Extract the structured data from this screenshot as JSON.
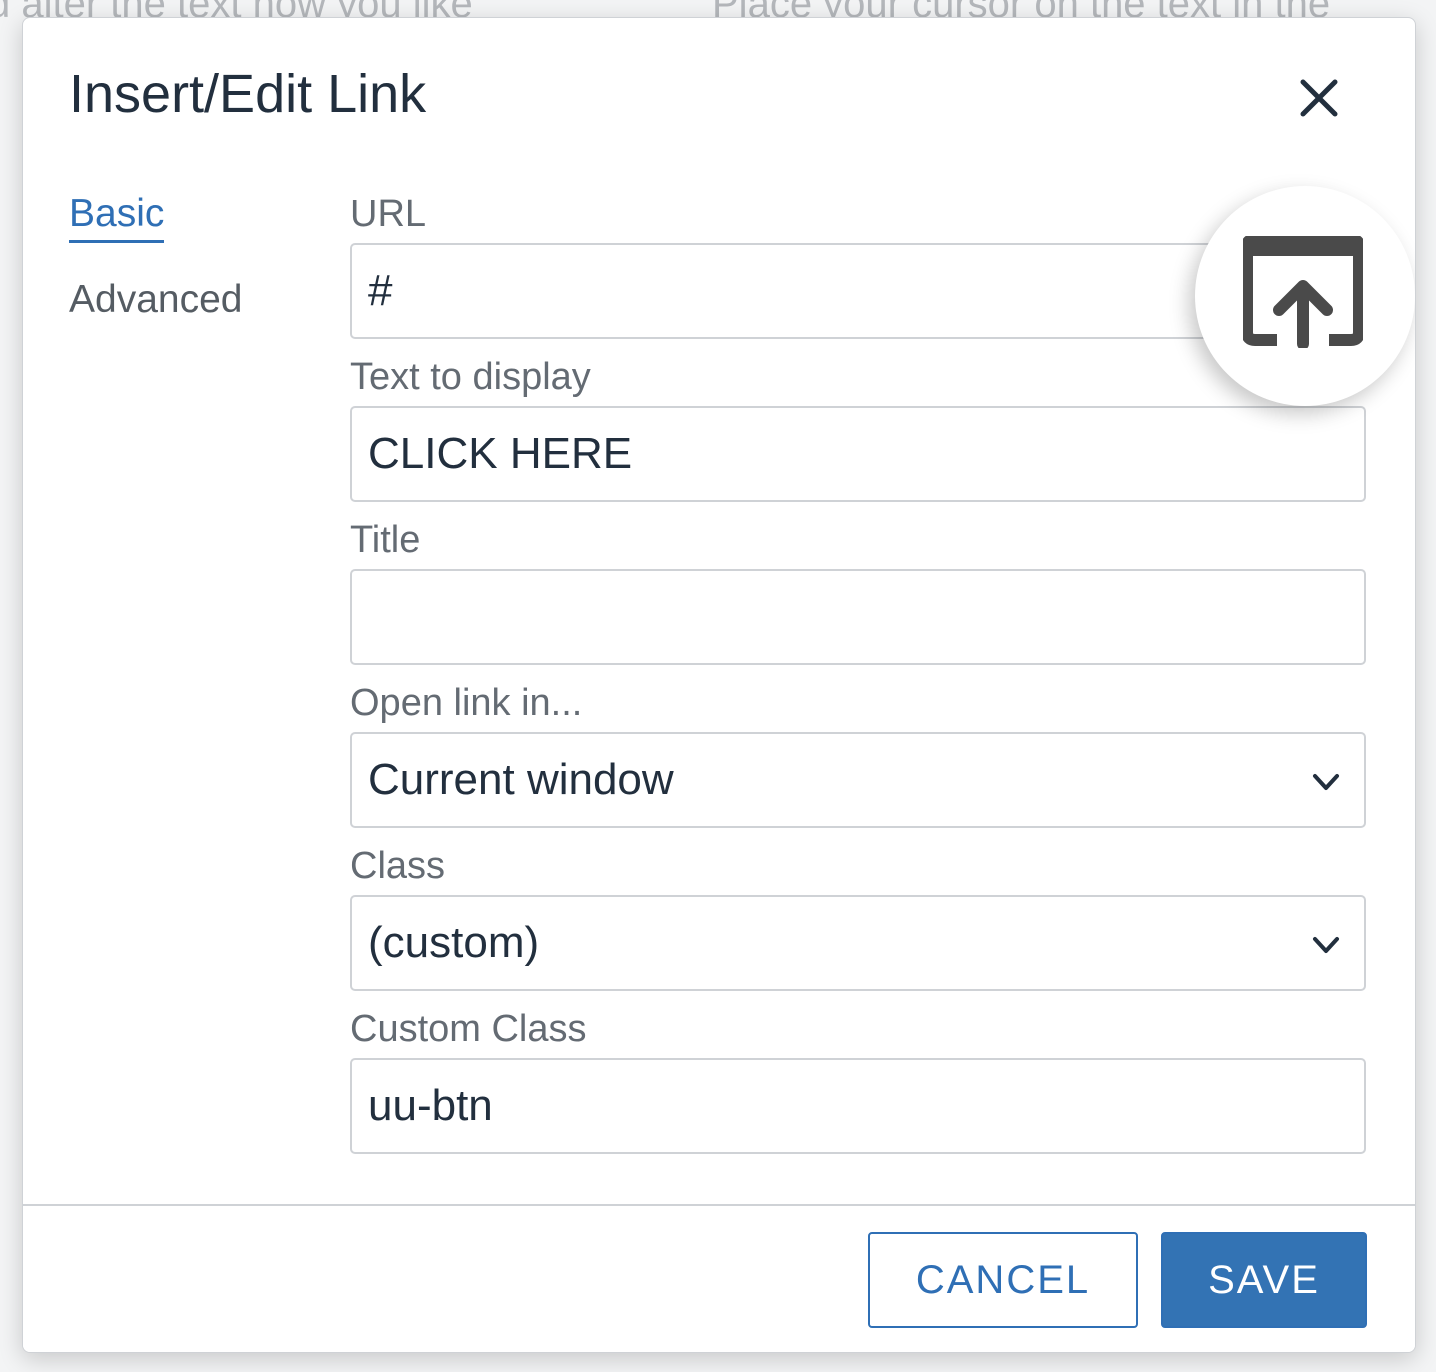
{
  "background": {
    "text_left": "d alter the text how you like",
    "text_right": "Place your cursor on the text in the"
  },
  "dialog": {
    "title": "Insert/Edit Link"
  },
  "nav": {
    "items": [
      {
        "label": "Basic",
        "active": true
      },
      {
        "label": "Advanced",
        "active": false
      }
    ]
  },
  "form": {
    "url": {
      "label": "URL",
      "value": "#"
    },
    "text_to_display": {
      "label": "Text to display",
      "value": "CLICK HERE"
    },
    "title": {
      "label": "Title",
      "value": ""
    },
    "open_link_in": {
      "label": "Open link in...",
      "value": "Current window"
    },
    "class": {
      "label": "Class",
      "value": "(custom)"
    },
    "custom_class": {
      "label": "Custom Class",
      "value": "uu-btn"
    }
  },
  "footer": {
    "cancel_label": "CANCEL",
    "save_label": "SAVE"
  },
  "icons": {
    "close": "close-icon",
    "open_link": "open-link-icon",
    "chevron": "chevron-down-icon"
  },
  "colors": {
    "accent": "#2f6fb5",
    "text": "#222f3e",
    "label": "#646b73",
    "border": "#cfd2d6"
  }
}
